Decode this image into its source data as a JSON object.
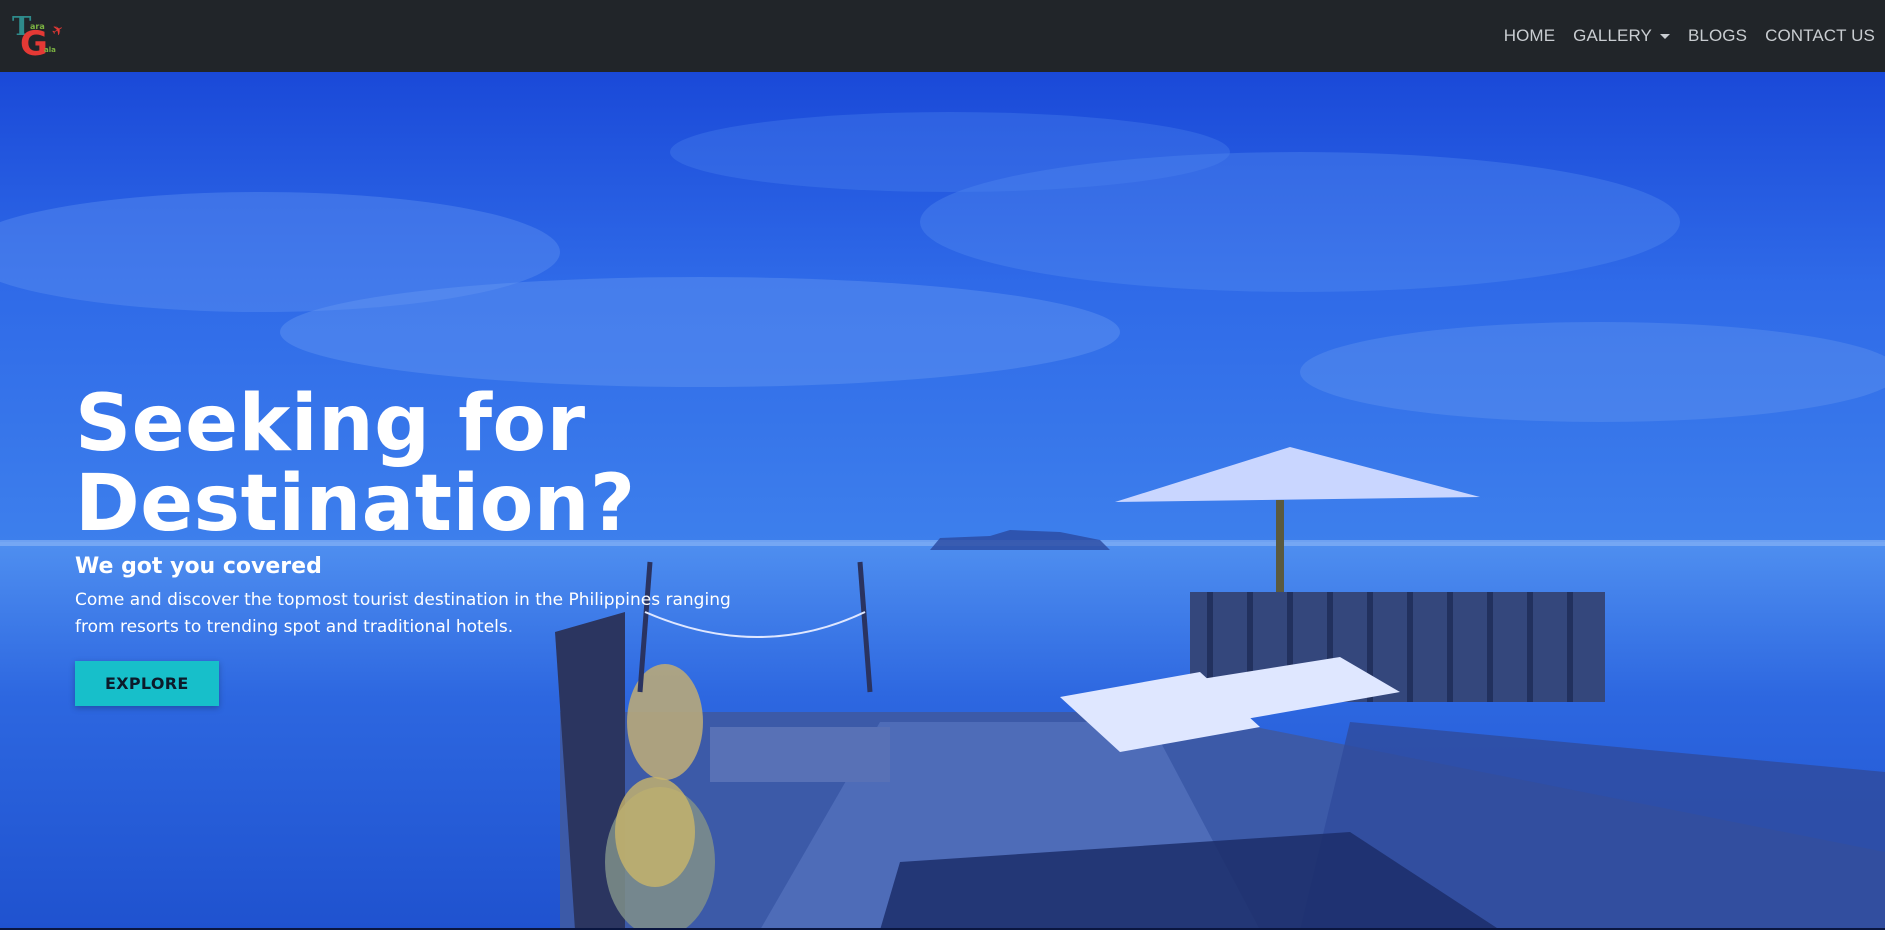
{
  "brand": {
    "logo_text_t": "T",
    "logo_text_g": "G",
    "logo_small_1": "ara",
    "logo_small_2": "ala",
    "plane_icon": "✈"
  },
  "nav": {
    "items": [
      {
        "label": "HOME"
      },
      {
        "label": "GALLERY",
        "has_dropdown": true
      },
      {
        "label": "BLOGS"
      },
      {
        "label": "CONTACT US"
      }
    ]
  },
  "hero": {
    "title_line1": "Seeking for",
    "title_line2": "Destination?",
    "subtitle": "We got you covered",
    "description": "Come and discover the topmost tourist destination in the Philippines ranging from resorts to trending spot and traditional hotels.",
    "button_label": "EXPLORE"
  },
  "colors": {
    "navbar_bg": "#212529",
    "nav_text": "#c9cdd1",
    "hero_tint": "#2a62e6",
    "button_bg": "#17bfca"
  }
}
